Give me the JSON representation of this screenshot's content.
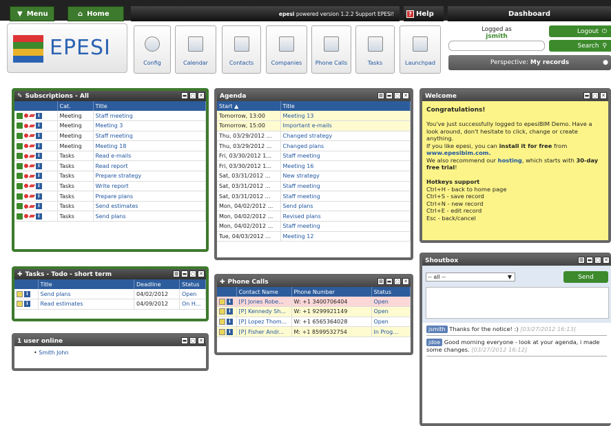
{
  "topbar": {
    "menu": "Menu",
    "home": "Home",
    "powered_app": "epesi",
    "powered_text": "powered version 1.2.2  Support EPESI!",
    "help": "Help",
    "help_icon": "?",
    "dashboard": "Dashboard"
  },
  "logo": {
    "text": "EPESI"
  },
  "launchers": [
    {
      "label": "Config",
      "icon": "gear-icon"
    },
    {
      "label": "Calendar",
      "icon": "calendar-icon"
    },
    {
      "label": "Contacts",
      "icon": "contacts-icon"
    },
    {
      "label": "Companies",
      "icon": "companies-icon"
    },
    {
      "label": "Phone Calls",
      "icon": "phone-icon"
    },
    {
      "label": "Tasks",
      "icon": "tasks-icon"
    },
    {
      "label": "Launchpad",
      "icon": "launchpad-icon"
    }
  ],
  "user": {
    "logged_as": "Logged as",
    "name": "jsmith",
    "logout": "Logout",
    "search": "Search",
    "search_value": "",
    "perspective_label": "Perspective:",
    "perspective_value": "My records"
  },
  "subscriptions": {
    "title": "Subscriptions - All",
    "headers": [
      "",
      "Cat.",
      "Title"
    ],
    "rows": [
      {
        "cat": "Meeting",
        "title": "Staff meeting"
      },
      {
        "cat": "Meeting",
        "title": "Meeting 3"
      },
      {
        "cat": "Meeting",
        "title": "Staff meeting"
      },
      {
        "cat": "Meeting",
        "title": "Meeting 18"
      },
      {
        "cat": "Tasks",
        "title": "Read e-mails"
      },
      {
        "cat": "Tasks",
        "title": "Read report"
      },
      {
        "cat": "Tasks",
        "title": "Prepare strategy"
      },
      {
        "cat": "Tasks",
        "title": "Write report"
      },
      {
        "cat": "Tasks",
        "title": "Prepare plans"
      },
      {
        "cat": "Tasks",
        "title": "Send estimates"
      },
      {
        "cat": "Tasks",
        "title": "Send plans"
      }
    ]
  },
  "agenda": {
    "title": "Agenda",
    "headers": [
      "Start ▲",
      "Title"
    ],
    "rows": [
      {
        "start": "Tomorrow, 13:00",
        "title": "Meeting 13",
        "hl": true
      },
      {
        "start": "Tomorrow, 15:00",
        "title": "Important e-mails",
        "hl": true
      },
      {
        "start": "Thu, 03/29/2012 ...",
        "title": "Changed strategy",
        "hl": false
      },
      {
        "start": "Thu, 03/29/2012 ...",
        "title": "Changed plans",
        "hl": false
      },
      {
        "start": "Fri, 03/30/2012 1...",
        "title": "Staff meeting",
        "hl": false
      },
      {
        "start": "Fri, 03/30/2012 1...",
        "title": "Meeting 16",
        "hl": false
      },
      {
        "start": "Sat, 03/31/2012 ...",
        "title": "New strategy",
        "hl": false
      },
      {
        "start": "Sat, 03/31/2012 ...",
        "title": "Staff meeting",
        "hl": false
      },
      {
        "start": "Sat, 03/31/2012 ...",
        "title": "Staff meeting",
        "hl": false
      },
      {
        "start": "Mon, 04/02/2012 ...",
        "title": "Send plans",
        "hl": false
      },
      {
        "start": "Mon, 04/02/2012 ...",
        "title": "Revised plans",
        "hl": false
      },
      {
        "start": "Mon, 04/02/2012 ...",
        "title": "Staff meeting",
        "hl": false
      },
      {
        "start": "Tue, 04/03/2012 ...",
        "title": "Meeting 12",
        "hl": false
      }
    ]
  },
  "welcome": {
    "title": "Welcome",
    "heading": "Congratulations!",
    "p1": "You've just successfully logged to epesiBIM Demo. Have a look around, don't hesitate to click, change or create anything.",
    "p2a": "If you like epesi, you can ",
    "p2b": "install it for free",
    "p2c": " from",
    "p2link": "www.epesibim.com.",
    "p3a": "We also recommend our ",
    "p3b": "hosting",
    "p3c": ", which starts with ",
    "p3d": "30-day free trial",
    "p3e": "!",
    "hotkeys_title": "Hotkeys support",
    "hotkeys": [
      "Ctrl+H - back to home page",
      "Ctrl+S - save record",
      "Ctrl+N - new record",
      "Ctrl+E - edit record",
      "Esc - back/cancel"
    ]
  },
  "tasks": {
    "title": "Tasks - Todo - short term",
    "headers": [
      "",
      "Title",
      "Deadline",
      "Status"
    ],
    "rows": [
      {
        "title": "Send plans",
        "deadline": "04/02/2012",
        "status": "Open"
      },
      {
        "title": "Read estimates",
        "deadline": "04/09/2012",
        "status": "On H..."
      }
    ]
  },
  "online": {
    "title": "1 user online",
    "users": [
      "Smith John"
    ]
  },
  "phone": {
    "title": "Phone Calls",
    "headers": [
      "",
      "Contact Name",
      "Phone Number",
      "Status"
    ],
    "rows": [
      {
        "name": "[P] Jones Robe...",
        "number": "W: +1 3400706404",
        "status": "Open",
        "style": "pink"
      },
      {
        "name": "[P] Kennedy Sh...",
        "number": "W: +1 9299921149",
        "status": "Open",
        "style": "yel"
      },
      {
        "name": "[P] Lopez Thom...",
        "number": "W: +1 6565364028",
        "status": "Open",
        "style": "none"
      },
      {
        "name": "[P] Fisher Andr...",
        "number": "M: +1 8599532754",
        "status": "In Prog...",
        "style": "yel"
      }
    ]
  },
  "shoutbox": {
    "title": "Shoutbox",
    "filter": "-- all --",
    "send": "Send",
    "messages": [
      {
        "user": "jsmith",
        "text": "Thanks for the notice! :)",
        "time": "[03/27/2012 16:13]"
      },
      {
        "user": "jdoe",
        "text": "Good morning everyone - look at your agenda, i made some changes.",
        "time": "[03/27/2012 16:12]"
      }
    ]
  }
}
